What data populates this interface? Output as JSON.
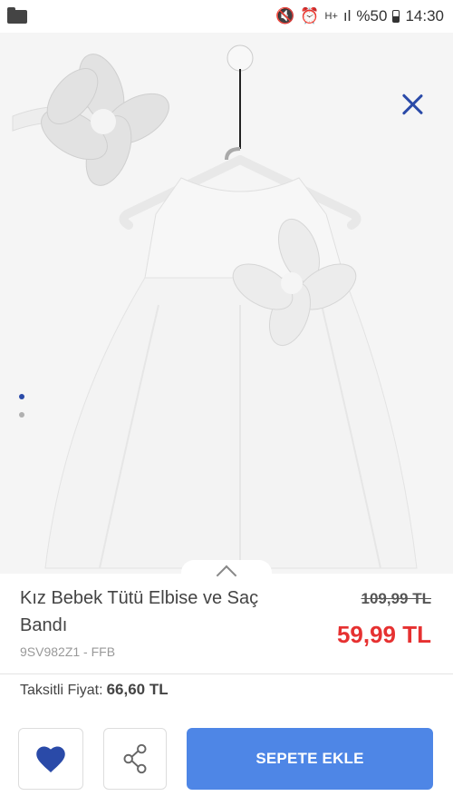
{
  "status_bar": {
    "network": "H+",
    "battery": "%50",
    "time": "14:30"
  },
  "product": {
    "title": "Kız Bebek Tütü Elbise ve Saç Bandı",
    "old_price": "109,99 TL",
    "new_price": "59,99 TL",
    "sku": "9SV982Z1 - FFB",
    "installment_label": "Taksitli Fiyat:",
    "installment_value": "66,60 TL"
  },
  "actions": {
    "add_to_cart": "SEPETE EKLE"
  },
  "icons": {
    "close": "close-icon",
    "favorite": "heart-icon",
    "share": "share-icon"
  },
  "colors": {
    "accent": "#2a4aa8",
    "cart_button": "#4e86e6",
    "sale_price": "#e63131"
  }
}
